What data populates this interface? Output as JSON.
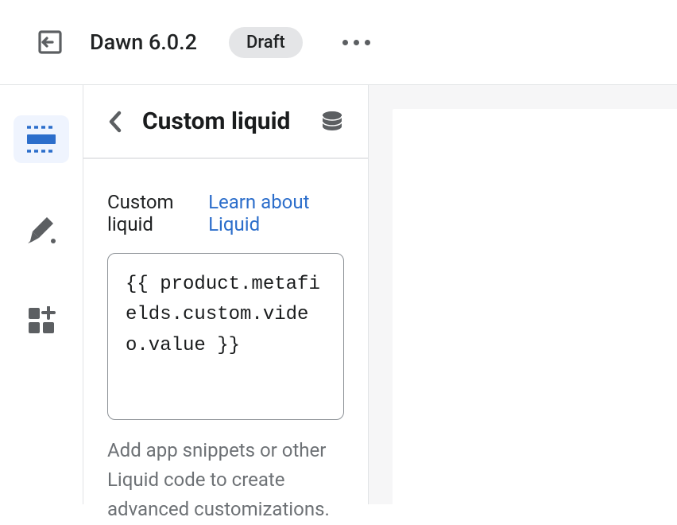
{
  "header": {
    "theme_name": "Dawn 6.0.2",
    "status_badge": "Draft"
  },
  "panel": {
    "title": "Custom liquid",
    "field_label": "Custom liquid",
    "learn_link": "Learn about Liquid",
    "code_value": "{{ product.metafields.custom.video.value }}",
    "help_text": "Add app snippets or other Liquid code to create advanced customizations."
  }
}
